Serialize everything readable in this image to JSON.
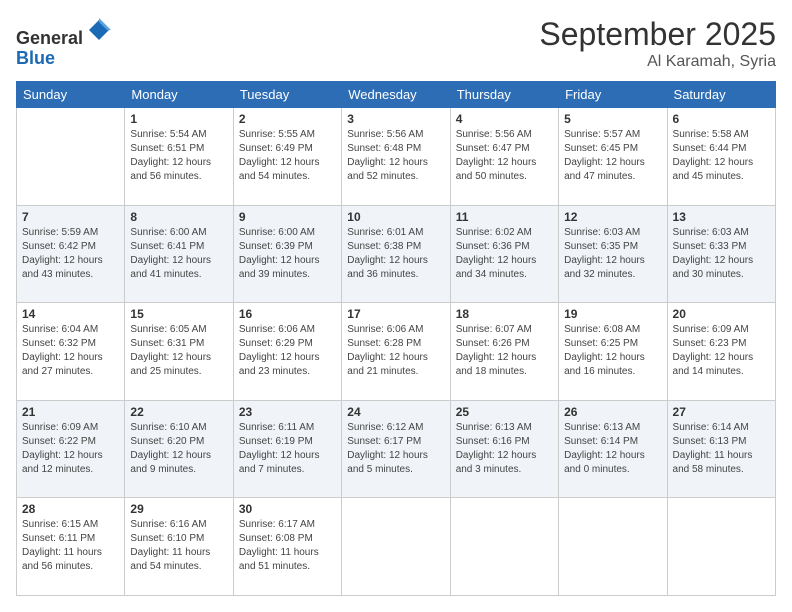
{
  "header": {
    "logo_line1": "General",
    "logo_line2": "Blue",
    "month_title": "September 2025",
    "location": "Al Karamah, Syria"
  },
  "days_of_week": [
    "Sunday",
    "Monday",
    "Tuesday",
    "Wednesday",
    "Thursday",
    "Friday",
    "Saturday"
  ],
  "weeks": [
    [
      {
        "day": "",
        "info": ""
      },
      {
        "day": "1",
        "info": "Sunrise: 5:54 AM\nSunset: 6:51 PM\nDaylight: 12 hours\nand 56 minutes."
      },
      {
        "day": "2",
        "info": "Sunrise: 5:55 AM\nSunset: 6:49 PM\nDaylight: 12 hours\nand 54 minutes."
      },
      {
        "day": "3",
        "info": "Sunrise: 5:56 AM\nSunset: 6:48 PM\nDaylight: 12 hours\nand 52 minutes."
      },
      {
        "day": "4",
        "info": "Sunrise: 5:56 AM\nSunset: 6:47 PM\nDaylight: 12 hours\nand 50 minutes."
      },
      {
        "day": "5",
        "info": "Sunrise: 5:57 AM\nSunset: 6:45 PM\nDaylight: 12 hours\nand 47 minutes."
      },
      {
        "day": "6",
        "info": "Sunrise: 5:58 AM\nSunset: 6:44 PM\nDaylight: 12 hours\nand 45 minutes."
      }
    ],
    [
      {
        "day": "7",
        "info": "Sunrise: 5:59 AM\nSunset: 6:42 PM\nDaylight: 12 hours\nand 43 minutes."
      },
      {
        "day": "8",
        "info": "Sunrise: 6:00 AM\nSunset: 6:41 PM\nDaylight: 12 hours\nand 41 minutes."
      },
      {
        "day": "9",
        "info": "Sunrise: 6:00 AM\nSunset: 6:39 PM\nDaylight: 12 hours\nand 39 minutes."
      },
      {
        "day": "10",
        "info": "Sunrise: 6:01 AM\nSunset: 6:38 PM\nDaylight: 12 hours\nand 36 minutes."
      },
      {
        "day": "11",
        "info": "Sunrise: 6:02 AM\nSunset: 6:36 PM\nDaylight: 12 hours\nand 34 minutes."
      },
      {
        "day": "12",
        "info": "Sunrise: 6:03 AM\nSunset: 6:35 PM\nDaylight: 12 hours\nand 32 minutes."
      },
      {
        "day": "13",
        "info": "Sunrise: 6:03 AM\nSunset: 6:33 PM\nDaylight: 12 hours\nand 30 minutes."
      }
    ],
    [
      {
        "day": "14",
        "info": "Sunrise: 6:04 AM\nSunset: 6:32 PM\nDaylight: 12 hours\nand 27 minutes."
      },
      {
        "day": "15",
        "info": "Sunrise: 6:05 AM\nSunset: 6:31 PM\nDaylight: 12 hours\nand 25 minutes."
      },
      {
        "day": "16",
        "info": "Sunrise: 6:06 AM\nSunset: 6:29 PM\nDaylight: 12 hours\nand 23 minutes."
      },
      {
        "day": "17",
        "info": "Sunrise: 6:06 AM\nSunset: 6:28 PM\nDaylight: 12 hours\nand 21 minutes."
      },
      {
        "day": "18",
        "info": "Sunrise: 6:07 AM\nSunset: 6:26 PM\nDaylight: 12 hours\nand 18 minutes."
      },
      {
        "day": "19",
        "info": "Sunrise: 6:08 AM\nSunset: 6:25 PM\nDaylight: 12 hours\nand 16 minutes."
      },
      {
        "day": "20",
        "info": "Sunrise: 6:09 AM\nSunset: 6:23 PM\nDaylight: 12 hours\nand 14 minutes."
      }
    ],
    [
      {
        "day": "21",
        "info": "Sunrise: 6:09 AM\nSunset: 6:22 PM\nDaylight: 12 hours\nand 12 minutes."
      },
      {
        "day": "22",
        "info": "Sunrise: 6:10 AM\nSunset: 6:20 PM\nDaylight: 12 hours\nand 9 minutes."
      },
      {
        "day": "23",
        "info": "Sunrise: 6:11 AM\nSunset: 6:19 PM\nDaylight: 12 hours\nand 7 minutes."
      },
      {
        "day": "24",
        "info": "Sunrise: 6:12 AM\nSunset: 6:17 PM\nDaylight: 12 hours\nand 5 minutes."
      },
      {
        "day": "25",
        "info": "Sunrise: 6:13 AM\nSunset: 6:16 PM\nDaylight: 12 hours\nand 3 minutes."
      },
      {
        "day": "26",
        "info": "Sunrise: 6:13 AM\nSunset: 6:14 PM\nDaylight: 12 hours\nand 0 minutes."
      },
      {
        "day": "27",
        "info": "Sunrise: 6:14 AM\nSunset: 6:13 PM\nDaylight: 11 hours\nand 58 minutes."
      }
    ],
    [
      {
        "day": "28",
        "info": "Sunrise: 6:15 AM\nSunset: 6:11 PM\nDaylight: 11 hours\nand 56 minutes."
      },
      {
        "day": "29",
        "info": "Sunrise: 6:16 AM\nSunset: 6:10 PM\nDaylight: 11 hours\nand 54 minutes."
      },
      {
        "day": "30",
        "info": "Sunrise: 6:17 AM\nSunset: 6:08 PM\nDaylight: 11 hours\nand 51 minutes."
      },
      {
        "day": "",
        "info": ""
      },
      {
        "day": "",
        "info": ""
      },
      {
        "day": "",
        "info": ""
      },
      {
        "day": "",
        "info": ""
      }
    ]
  ]
}
